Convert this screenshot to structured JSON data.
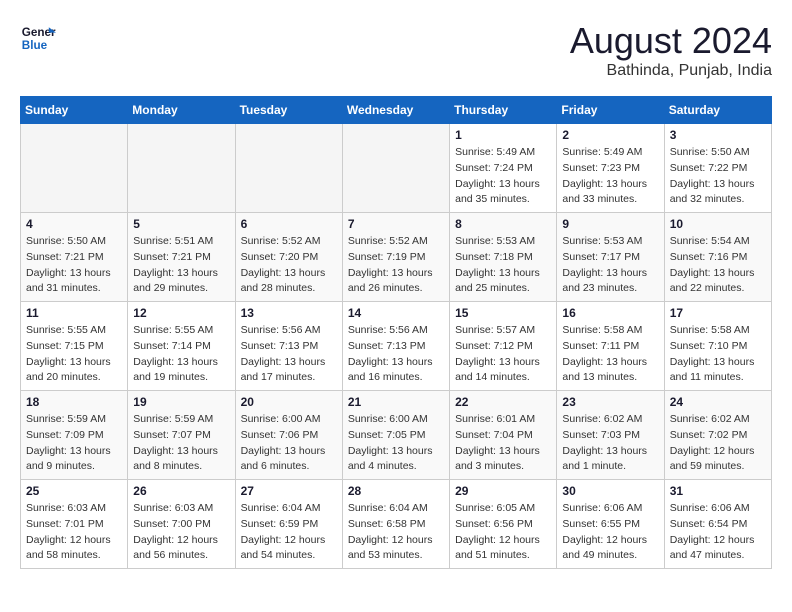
{
  "logo": {
    "line1": "General",
    "line2": "Blue"
  },
  "title": "August 2024",
  "location": "Bathinda, Punjab, India",
  "weekdays": [
    "Sunday",
    "Monday",
    "Tuesday",
    "Wednesday",
    "Thursday",
    "Friday",
    "Saturday"
  ],
  "weeks": [
    [
      {
        "day": "",
        "info": ""
      },
      {
        "day": "",
        "info": ""
      },
      {
        "day": "",
        "info": ""
      },
      {
        "day": "",
        "info": ""
      },
      {
        "day": "1",
        "info": "Sunrise: 5:49 AM\nSunset: 7:24 PM\nDaylight: 13 hours\nand 35 minutes."
      },
      {
        "day": "2",
        "info": "Sunrise: 5:49 AM\nSunset: 7:23 PM\nDaylight: 13 hours\nand 33 minutes."
      },
      {
        "day": "3",
        "info": "Sunrise: 5:50 AM\nSunset: 7:22 PM\nDaylight: 13 hours\nand 32 minutes."
      }
    ],
    [
      {
        "day": "4",
        "info": "Sunrise: 5:50 AM\nSunset: 7:21 PM\nDaylight: 13 hours\nand 31 minutes."
      },
      {
        "day": "5",
        "info": "Sunrise: 5:51 AM\nSunset: 7:21 PM\nDaylight: 13 hours\nand 29 minutes."
      },
      {
        "day": "6",
        "info": "Sunrise: 5:52 AM\nSunset: 7:20 PM\nDaylight: 13 hours\nand 28 minutes."
      },
      {
        "day": "7",
        "info": "Sunrise: 5:52 AM\nSunset: 7:19 PM\nDaylight: 13 hours\nand 26 minutes."
      },
      {
        "day": "8",
        "info": "Sunrise: 5:53 AM\nSunset: 7:18 PM\nDaylight: 13 hours\nand 25 minutes."
      },
      {
        "day": "9",
        "info": "Sunrise: 5:53 AM\nSunset: 7:17 PM\nDaylight: 13 hours\nand 23 minutes."
      },
      {
        "day": "10",
        "info": "Sunrise: 5:54 AM\nSunset: 7:16 PM\nDaylight: 13 hours\nand 22 minutes."
      }
    ],
    [
      {
        "day": "11",
        "info": "Sunrise: 5:55 AM\nSunset: 7:15 PM\nDaylight: 13 hours\nand 20 minutes."
      },
      {
        "day": "12",
        "info": "Sunrise: 5:55 AM\nSunset: 7:14 PM\nDaylight: 13 hours\nand 19 minutes."
      },
      {
        "day": "13",
        "info": "Sunrise: 5:56 AM\nSunset: 7:13 PM\nDaylight: 13 hours\nand 17 minutes."
      },
      {
        "day": "14",
        "info": "Sunrise: 5:56 AM\nSunset: 7:13 PM\nDaylight: 13 hours\nand 16 minutes."
      },
      {
        "day": "15",
        "info": "Sunrise: 5:57 AM\nSunset: 7:12 PM\nDaylight: 13 hours\nand 14 minutes."
      },
      {
        "day": "16",
        "info": "Sunrise: 5:58 AM\nSunset: 7:11 PM\nDaylight: 13 hours\nand 13 minutes."
      },
      {
        "day": "17",
        "info": "Sunrise: 5:58 AM\nSunset: 7:10 PM\nDaylight: 13 hours\nand 11 minutes."
      }
    ],
    [
      {
        "day": "18",
        "info": "Sunrise: 5:59 AM\nSunset: 7:09 PM\nDaylight: 13 hours\nand 9 minutes."
      },
      {
        "day": "19",
        "info": "Sunrise: 5:59 AM\nSunset: 7:07 PM\nDaylight: 13 hours\nand 8 minutes."
      },
      {
        "day": "20",
        "info": "Sunrise: 6:00 AM\nSunset: 7:06 PM\nDaylight: 13 hours\nand 6 minutes."
      },
      {
        "day": "21",
        "info": "Sunrise: 6:00 AM\nSunset: 7:05 PM\nDaylight: 13 hours\nand 4 minutes."
      },
      {
        "day": "22",
        "info": "Sunrise: 6:01 AM\nSunset: 7:04 PM\nDaylight: 13 hours\nand 3 minutes."
      },
      {
        "day": "23",
        "info": "Sunrise: 6:02 AM\nSunset: 7:03 PM\nDaylight: 13 hours\nand 1 minute."
      },
      {
        "day": "24",
        "info": "Sunrise: 6:02 AM\nSunset: 7:02 PM\nDaylight: 12 hours\nand 59 minutes."
      }
    ],
    [
      {
        "day": "25",
        "info": "Sunrise: 6:03 AM\nSunset: 7:01 PM\nDaylight: 12 hours\nand 58 minutes."
      },
      {
        "day": "26",
        "info": "Sunrise: 6:03 AM\nSunset: 7:00 PM\nDaylight: 12 hours\nand 56 minutes."
      },
      {
        "day": "27",
        "info": "Sunrise: 6:04 AM\nSunset: 6:59 PM\nDaylight: 12 hours\nand 54 minutes."
      },
      {
        "day": "28",
        "info": "Sunrise: 6:04 AM\nSunset: 6:58 PM\nDaylight: 12 hours\nand 53 minutes."
      },
      {
        "day": "29",
        "info": "Sunrise: 6:05 AM\nSunset: 6:56 PM\nDaylight: 12 hours\nand 51 minutes."
      },
      {
        "day": "30",
        "info": "Sunrise: 6:06 AM\nSunset: 6:55 PM\nDaylight: 12 hours\nand 49 minutes."
      },
      {
        "day": "31",
        "info": "Sunrise: 6:06 AM\nSunset: 6:54 PM\nDaylight: 12 hours\nand 47 minutes."
      }
    ]
  ]
}
